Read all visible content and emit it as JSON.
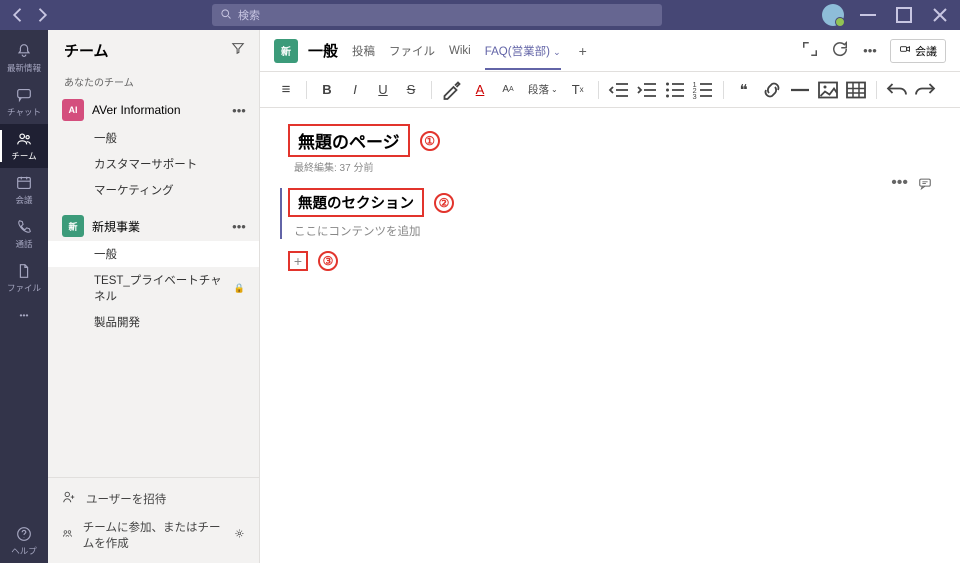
{
  "titlebar": {
    "search_placeholder": "検索"
  },
  "rail": {
    "items": [
      {
        "label": "最新情報"
      },
      {
        "label": "チャット"
      },
      {
        "label": "チーム"
      },
      {
        "label": "会議"
      },
      {
        "label": "通話"
      },
      {
        "label": "ファイル"
      }
    ],
    "help_label": "ヘルプ"
  },
  "sidepanel": {
    "title": "チーム",
    "your_teams": "あなたのチーム",
    "teams": [
      {
        "name": "AVer Information",
        "badge": "AI",
        "channels": [
          {
            "name": "一般"
          },
          {
            "name": "カスタマーサポート"
          },
          {
            "name": "マーケティング"
          }
        ]
      },
      {
        "name": "新規事業",
        "badge": "新",
        "channels": [
          {
            "name": "一般"
          },
          {
            "name": "TEST_プライベートチャネル",
            "private": true
          },
          {
            "name": "製品開発"
          }
        ]
      }
    ],
    "invite": "ユーザーを招待",
    "join_create": "チームに参加、またはチームを作成"
  },
  "main": {
    "channel_badge": "新",
    "channel_name": "一般",
    "tabs": [
      {
        "label": "投稿"
      },
      {
        "label": "ファイル"
      },
      {
        "label": "Wiki"
      },
      {
        "label": "FAQ(営業部)",
        "active": true
      }
    ],
    "meet_label": "会議",
    "toolbar": {
      "paragraph_label": "段落"
    },
    "page": {
      "title": "無題のページ",
      "last_edit": "最終編集: 37 分前",
      "section_title": "無題のセクション",
      "placeholder": "ここにコンテンツを追加"
    },
    "annotations": {
      "a1": "①",
      "a2": "②",
      "a3": "③"
    }
  }
}
